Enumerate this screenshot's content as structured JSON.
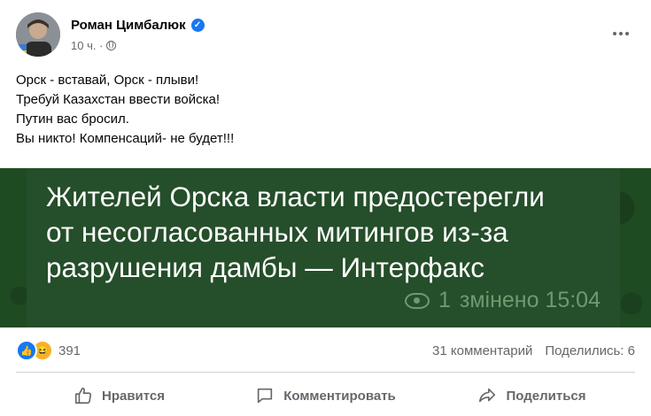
{
  "post": {
    "author": "Роман Цимбалюк",
    "time": "10 ч. ·",
    "lines": [
      "Орск - вставай, Орск - плыви!",
      "Требуй Казахстан ввести войска!",
      "Путин вас бросил.",
      "Вы никто! Компенсаций- не будет!!!"
    ]
  },
  "image": {
    "headline_lines": [
      "Жителей Орска власти предостерегли",
      "от несогласованных митингов из-за",
      "разрушения дамбы — Интерфакс"
    ],
    "views": "1",
    "edited": "змінено 15:04"
  },
  "stats": {
    "reactions_count": "391",
    "comments": "31 комментарий",
    "shares": "Поделились: 6"
  },
  "actions": {
    "like": "Нравится",
    "comment": "Комментировать",
    "share": "Поделиться"
  },
  "colors": {
    "facebook_blue": "#1877f2",
    "telegram_green": "#254e2a",
    "muted_text": "#65676b"
  },
  "icons": [
    "verified-badge-icon",
    "globe-icon",
    "more-options-icon",
    "eye-icon",
    "like-reaction-icon",
    "haha-reaction-icon",
    "thumbs-up-icon",
    "comment-icon",
    "share-icon"
  ]
}
